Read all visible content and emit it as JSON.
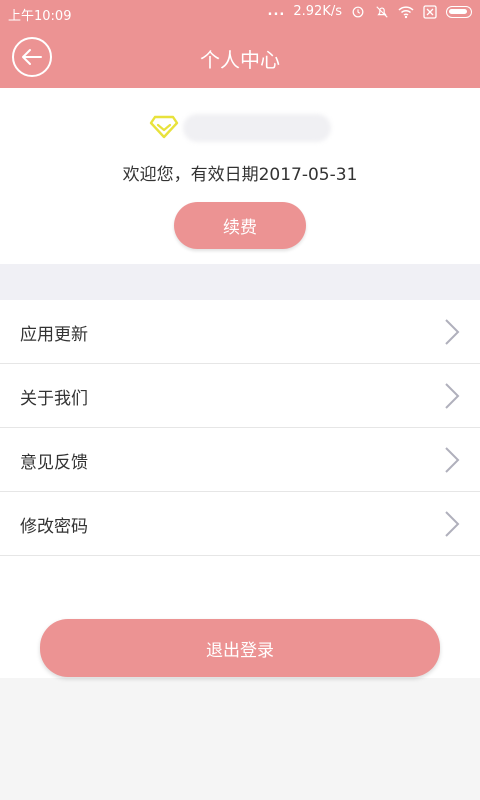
{
  "status_bar": {
    "time": "上午10:09",
    "dots": "...",
    "net_speed": "2.92K/s"
  },
  "header": {
    "title": "个人中心"
  },
  "profile": {
    "welcome": "欢迎您，有效日期2017-05-31",
    "renew_label": "续费"
  },
  "menu": {
    "items": [
      {
        "label": "应用更新"
      },
      {
        "label": "关于我们"
      },
      {
        "label": "意见反馈"
      },
      {
        "label": "修改密码"
      }
    ]
  },
  "logout": {
    "label": "退出登录"
  },
  "colors": {
    "accent": "#ec9393",
    "vip": "#e8e23c"
  },
  "icons": [
    "back-arrow-icon",
    "vip-diamond-icon",
    "chevron-right-icon",
    "wifi-icon",
    "alarm-icon",
    "mute-icon",
    "battery-icon"
  ]
}
